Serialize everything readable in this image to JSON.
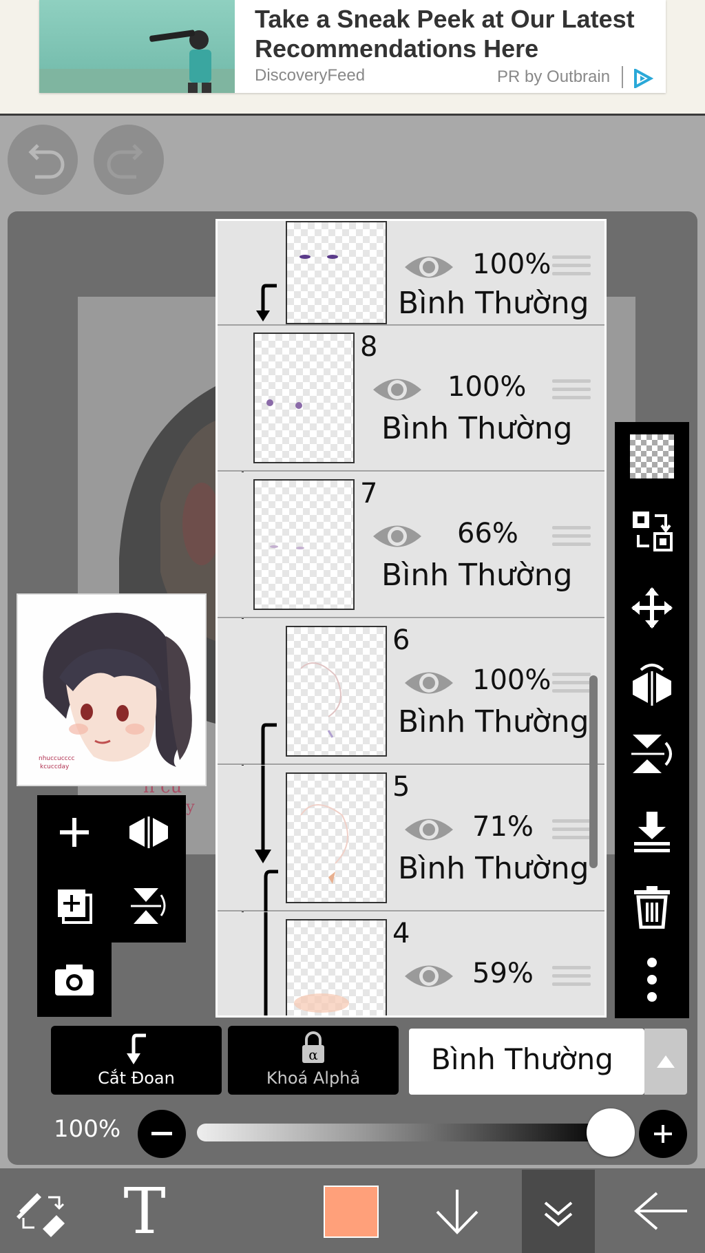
{
  "ad": {
    "title": "Take a Sneak Peek at Our Latest Recommendations Here",
    "source": "DiscoveryFeed",
    "pr": "PR by Outbrain"
  },
  "layers": [
    {
      "number": "",
      "opacity": "100%",
      "mode": "Bình Thường"
    },
    {
      "number": "8",
      "opacity": "100%",
      "mode": "Bình Thường"
    },
    {
      "number": "7",
      "opacity": "66%",
      "mode": "Bình Thường"
    },
    {
      "number": "6",
      "opacity": "100%",
      "mode": "Bình Thường"
    },
    {
      "number": "5",
      "opacity": "71%",
      "mode": "Bình Thường"
    },
    {
      "number": "4",
      "opacity": "59%",
      "mode": ""
    }
  ],
  "bottom_controls": {
    "clip_label": "Cắt Đoan",
    "alpha_label": "Khoá Alphả",
    "blend_mode": "Bình Thường",
    "opacity_label": "100%",
    "opacity_value": 1.0
  },
  "colors": {
    "current_color": "#ffa07a"
  }
}
